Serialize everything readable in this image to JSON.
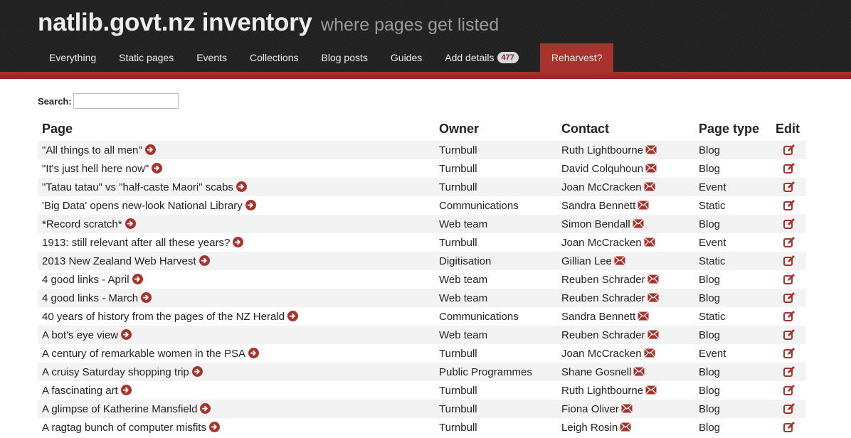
{
  "site": {
    "title": "natlib.govt.nz inventory",
    "subtitle": "where pages get listed"
  },
  "nav": {
    "everything": "Everything",
    "static_pages": "Static pages",
    "events": "Events",
    "collections": "Collections",
    "blog_posts": "Blog posts",
    "guides": "Guides",
    "add_details": "Add details",
    "add_details_count": "477",
    "reharvest": "Reharvest?"
  },
  "search": {
    "label": "Search:",
    "value": ""
  },
  "table": {
    "headers": {
      "page": "Page",
      "owner": "Owner",
      "contact": "Contact",
      "page_type": "Page type",
      "edit": "Edit"
    },
    "rows": [
      {
        "page": "\"All things to all men\"",
        "owner": "Turnbull",
        "contact": "Ruth Lightbourne",
        "type": "Blog"
      },
      {
        "page": "\"It's just hell here now\"",
        "owner": "Turnbull",
        "contact": "David Colquhoun",
        "type": "Blog"
      },
      {
        "page": "\"Tatau tatau\" vs \"half-caste Maori\" scabs",
        "owner": "Turnbull",
        "contact": "Joan McCracken",
        "type": "Event"
      },
      {
        "page": "'Big Data' opens new-look National Library",
        "owner": "Communications",
        "contact": "Sandra Bennett",
        "type": "Static"
      },
      {
        "page": "*Record scratch*",
        "owner": "Web team",
        "contact": "Simon Bendall",
        "type": "Blog"
      },
      {
        "page": "1913: still relevant after all these years?",
        "owner": "Turnbull",
        "contact": "Joan McCracken",
        "type": "Event"
      },
      {
        "page": "2013 New Zealand Web Harvest",
        "owner": "Digitisation",
        "contact": "Gillian Lee",
        "type": "Static"
      },
      {
        "page": "4 good links - April",
        "owner": "Web team",
        "contact": "Reuben Schrader",
        "type": "Blog"
      },
      {
        "page": "4 good links - March",
        "owner": "Web team",
        "contact": "Reuben Schrader",
        "type": "Blog"
      },
      {
        "page": "40 years of history from the pages of the NZ Herald",
        "owner": "Communications",
        "contact": "Sandra Bennett",
        "type": "Static"
      },
      {
        "page": "A bot's eye view",
        "owner": "Web team",
        "contact": "Reuben Schrader",
        "type": "Blog"
      },
      {
        "page": "A century of remarkable women in the PSA",
        "owner": "Turnbull",
        "contact": "Joan McCracken",
        "type": "Event"
      },
      {
        "page": "A cruisy Saturday shopping trip",
        "owner": "Public Programmes",
        "contact": "Shane Gosnell",
        "type": "Blog"
      },
      {
        "page": "A fascinating art",
        "owner": "Turnbull",
        "contact": "Ruth Lightbourne",
        "type": "Blog"
      },
      {
        "page": "A glimpse of Katherine Mansfield",
        "owner": "Turnbull",
        "contact": "Fiona Oliver",
        "type": "Blog"
      },
      {
        "page": "A ragtag bunch of computer misfits",
        "owner": "Turnbull",
        "contact": "Leigh Rosin",
        "type": "Blog"
      }
    ]
  },
  "icons": {
    "go": "arrow-circle-right-icon",
    "mail": "envelope-icon",
    "edit": "edit-icon"
  },
  "colors": {
    "accent": "#a8322c",
    "header_bg": "#222222",
    "icon": "#a8322c"
  }
}
